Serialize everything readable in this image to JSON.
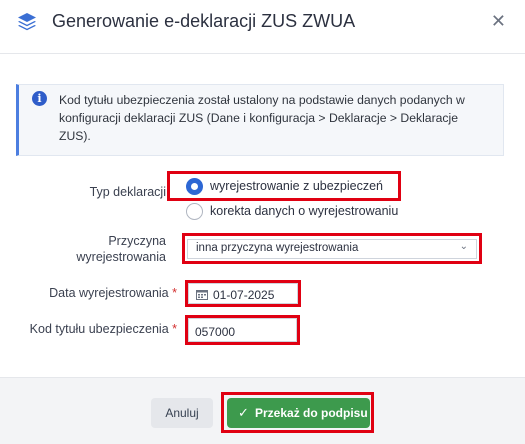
{
  "dialog": {
    "title": "Generowanie e-deklaracji ZUS ZWUA",
    "close_symbol": "✕",
    "logo_icon": "stack-layers-icon"
  },
  "info": {
    "icon": "info-icon",
    "icon_glyph": "i",
    "text": "Kod tytułu ubezpieczenia został ustalony na podstawie danych podanych w konfiguracji deklaracji ZUS (Dane i konfiguracja > Deklaracje > Deklaracje ZUS)."
  },
  "form": {
    "typ_deklaracji_label": "Typ deklaracji",
    "options": [
      {
        "label": "wyrejestrowanie z ubezpieczeń",
        "selected": true
      },
      {
        "label": "korekta danych o wyrejestrowaniu",
        "selected": false
      }
    ],
    "przyczyna_label_line1": "Przyczyna",
    "przyczyna_label_line2": "wyrejestrowania",
    "przyczyna_value": "inna przyczyna wyrejestrowania",
    "data_label": "Data wyrejestrowania",
    "data_value": "01-07-2025",
    "kod_label": "Kod tytułu ubezpieczenia",
    "kod_value": "057000",
    "required_mark": "*"
  },
  "footer": {
    "cancel_label": "Anuluj",
    "submit_label": "Przekaż do podpisu",
    "submit_icon_glyph": "✓"
  },
  "colors": {
    "accent": "#2d67d4",
    "success": "#3d9a4d",
    "highlight": "#e00012"
  }
}
